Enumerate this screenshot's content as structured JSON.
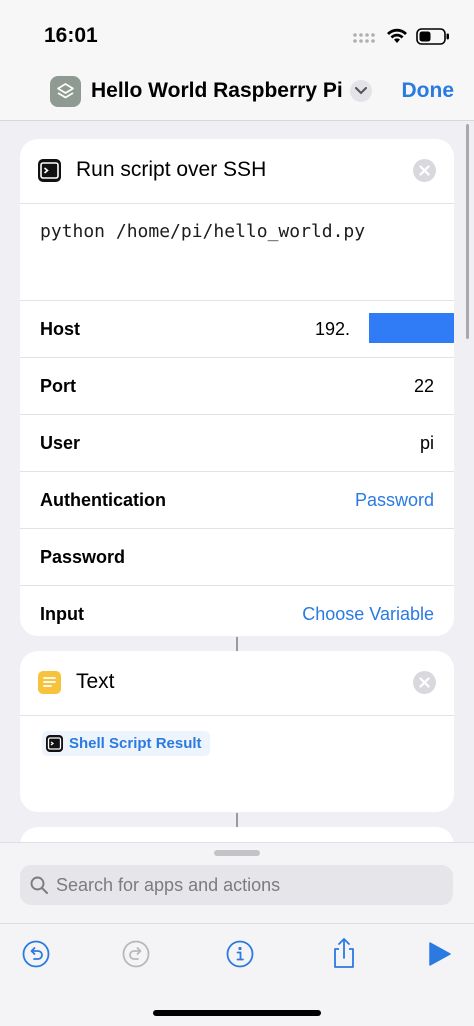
{
  "status_bar": {
    "time": "16:01"
  },
  "nav": {
    "title": "Hello World Raspberry Pi",
    "done_label": "Done",
    "icon": "shortcut-layers-icon"
  },
  "ssh_action": {
    "title": "Run script over SSH",
    "script": "python /home/pi/hello_world.py",
    "fields": [
      {
        "label": "Host",
        "value": "192."
      },
      {
        "label": "Port",
        "value": "22"
      },
      {
        "label": "User",
        "value": "pi"
      },
      {
        "label": "Authentication",
        "value": "Password"
      },
      {
        "label": "Password",
        "value": ""
      },
      {
        "label": "Input",
        "value": "Choose Variable"
      }
    ]
  },
  "text_action": {
    "title": "Text",
    "token_label": "Shell Script Result"
  },
  "search": {
    "placeholder": "Search for apps and actions"
  },
  "toolbar": {
    "icons": [
      "undo-icon",
      "redo-icon",
      "info-icon",
      "share-icon",
      "play-icon"
    ]
  },
  "colors": {
    "accent": "#2a7ae2",
    "redaction": "#2f7cf6",
    "text_action_icon": "#f8c33c"
  }
}
